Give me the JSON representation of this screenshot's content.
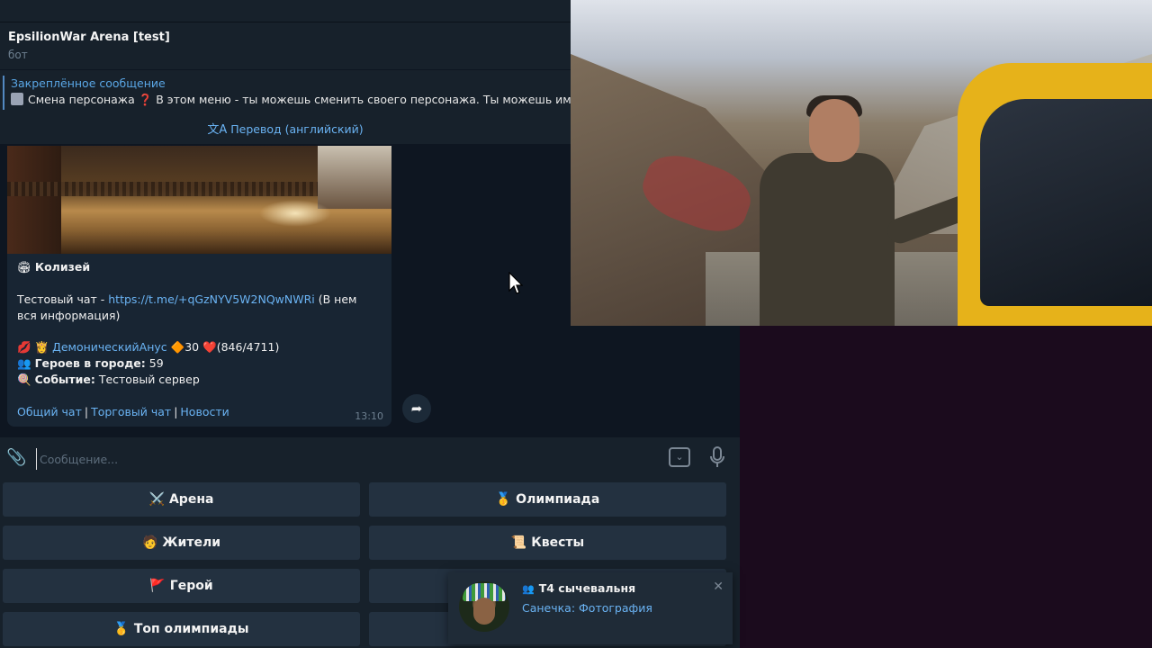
{
  "chat": {
    "title": "EpsilionWar Arena [test]",
    "subtitle": "бот",
    "pinned": {
      "title": "Закреплённое сообщение",
      "text": "Смена персонажа  ❓ В этом меню - ты можешь сменить своего персонажа. Ты можешь иметь"
    },
    "translate_label": "Перевод (английский)",
    "translate_icon": "文A"
  },
  "message": {
    "location_emoji": "🏟",
    "location": "Колизей",
    "test_chat_prefix": "Тестовый чат - ",
    "test_chat_link": "https://t.me/+qGzNYV5W2NQwNWRi",
    "test_chat_suffix": " (В нем вся информация)",
    "hero_emojis": "💋 👸",
    "hero_name": "ДемоническийАнус",
    "hero_level_icon": "🔶",
    "hero_level": "30",
    "hero_hp_icon": "❤️",
    "hero_hp": "(846/4711)",
    "heroes_icon": "👥",
    "heroes_label": "Героев в городе:",
    "heroes_count": "59",
    "event_icon": "🍭",
    "event_label": "Событие:",
    "event_value": "Тестовый сервер",
    "footer_links": [
      "Общий чат",
      "Торговый чат",
      "Новости"
    ],
    "time": "13:10"
  },
  "composer": {
    "placeholder": "Сообщение..."
  },
  "keyboard": [
    {
      "emoji": "⚔️",
      "label": "Арена"
    },
    {
      "emoji": "🥇",
      "label": "Олимпиада"
    },
    {
      "emoji": "🧑",
      "label": "Жители"
    },
    {
      "emoji": "📜",
      "label": "Квесты"
    },
    {
      "emoji": "🚩",
      "label": "Герой"
    },
    {
      "emoji": "",
      "label": ""
    },
    {
      "emoji": "🥇",
      "label": "Топ олимпиады"
    },
    {
      "emoji": "",
      "label": ""
    }
  ],
  "notification": {
    "group_icon": "👥",
    "title": "Т4 сычевальня",
    "text": "Санечка: Фотография",
    "close": "✕"
  },
  "colors": {
    "chat_bg": "#0e1621",
    "panel_bg": "#17212b",
    "link": "#6ab3f3",
    "button_bg": "#233140",
    "outside_bg": "#1b0b1d"
  }
}
